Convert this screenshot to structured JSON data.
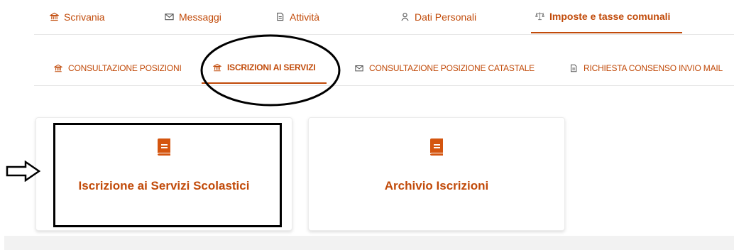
{
  "topnav": {
    "items": [
      {
        "label": "Scrivania",
        "icon": "bank-icon"
      },
      {
        "label": "Messaggi",
        "icon": "envelope-icon"
      },
      {
        "label": "Attività",
        "icon": "document-icon"
      },
      {
        "label": "Dati Personali",
        "icon": "user-icon"
      },
      {
        "label": "Imposte e tasse comunali",
        "icon": "scales-icon",
        "active": true
      }
    ]
  },
  "subnav": {
    "items": [
      {
        "label": "CONSULTAZIONE POSIZIONI",
        "icon": "bank-icon"
      },
      {
        "label": "ISCRIZIONI AI SERVIZI",
        "icon": "bank-icon",
        "active": true
      },
      {
        "label": "CONSULTAZIONE POSIZIONE CATASTALE",
        "icon": "envelope-icon"
      },
      {
        "label": "RICHIESTA CONSENSO INVIO MAIL",
        "icon": "document-icon"
      }
    ]
  },
  "cards": [
    {
      "title": "Iscrizione ai Servizi Scolastici",
      "icon": "book-icon"
    },
    {
      "title": "Archivio Iscrizioni",
      "icon": "book-icon"
    }
  ],
  "colors": {
    "accent": "#c14a09",
    "divider": "#e6e6e6",
    "annotation": "#000000"
  }
}
